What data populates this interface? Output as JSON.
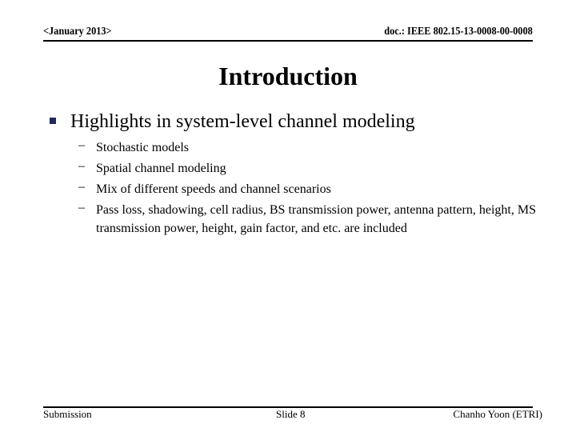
{
  "header": {
    "date": "<January 2013>",
    "doc_id": "doc.: IEEE 802.15-13-0008-00-0008"
  },
  "slide": {
    "title": "Introduction",
    "bullet": "Highlights in system-level channel modeling",
    "sub_bullets": [
      "Stochastic models",
      "Spatial channel modeling",
      "Mix of different speeds and channel scenarios",
      "Pass loss, shadowing, cell radius, BS transmission power, antenna pattern, height, MS transmission power, height, gain factor, and etc. are included"
    ],
    "dash_glyph": "–",
    "bullet_color": "#1f2a5a"
  },
  "footer": {
    "left": "Submission",
    "center": "Slide 8",
    "right": "Chanho Yoon (ETRI)"
  }
}
